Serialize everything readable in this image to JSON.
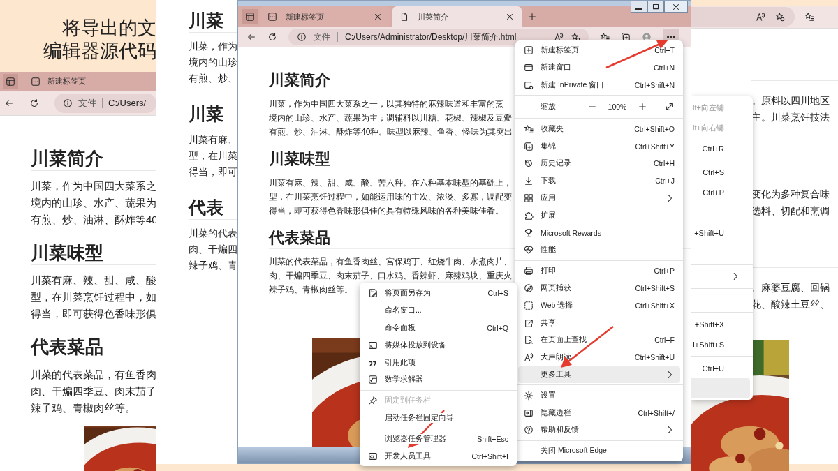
{
  "slide_title": [
    "将导出的文",
    "编辑器源代码"
  ],
  "left_window": {
    "tab": "新建标签页",
    "address_label": "文件",
    "address": "C:/Users/",
    "sections": [
      {
        "heading": "川菜简介",
        "lines": [
          "川菜，作为中国四大菜系之",
          "境内的山珍、水产、蔬果为",
          "有煎、炒、油淋、酥炸等40"
        ]
      },
      {
        "heading": "川菜味型",
        "lines": [
          "川菜有麻、辣、甜、咸、酸",
          "型，在川菜烹饪过程中，如",
          "得当，即可获得色香味形俱"
        ]
      },
      {
        "heading": "代表菜品",
        "lines": [
          "川菜的代表菜品，有鱼香肉",
          "肉、干煸四季豆、肉末茄子",
          "辣子鸡、青椒肉丝等。"
        ]
      }
    ],
    "picture": {
      "kind": "picture"
    }
  },
  "middle_page": {
    "sections": [
      {
        "heading": "川菜",
        "lines": [
          "川菜，作为",
          "境内的山珍",
          "有煎、炒、"
        ]
      },
      {
        "heading": "川菜",
        "lines": [
          "川菜有麻、",
          "型，在川菜",
          "得当，即可"
        ]
      },
      {
        "heading": "代表",
        "lines": [
          "川菜的代表",
          "肉、干煸四",
          "辣子鸡、青"
        ]
      }
    ]
  },
  "right_window": {
    "menu_groups": [
      [
        {
          "kind": "item",
          "shortcut": "lt+向左键",
          "disabled": true,
          "highlighted": false
        },
        {
          "kind": "item",
          "shortcut": "lt+向右键",
          "disabled": true,
          "highlighted": false
        },
        {
          "kind": "item",
          "shortcut": "Ctrl+R",
          "disabled": false,
          "highlighted": false
        }
      ],
      [
        {
          "kind": "item",
          "shortcut": "Ctrl+S",
          "disabled": false,
          "highlighted": false
        },
        {
          "kind": "item",
          "shortcut": "Ctrl+P",
          "disabled": false,
          "highlighted": false
        },
        {
          "kind": "blank"
        },
        {
          "kind": "item",
          "shortcut": "+Shift+U",
          "disabled": false,
          "highlighted": false
        },
        {
          "kind": "blank"
        }
      ],
      [
        {
          "kind": "item",
          "submenu": true,
          "highlighted": false
        }
      ],
      [
        {
          "kind": "blank"
        }
      ],
      [
        {
          "kind": "item",
          "shortcut": "+Shift+X",
          "disabled": false,
          "highlighted": false
        },
        {
          "kind": "item",
          "shortcut": "l+Shift+S",
          "disabled": false,
          "highlighted": false
        }
      ],
      [
        {
          "kind": "item",
          "shortcut": "Ctrl+U",
          "disabled": false,
          "highlighted": false
        },
        {
          "kind": "item",
          "highlighted": true
        }
      ]
    ],
    "sections": [
      {
        "lines": [
          "。原料以四川地区",
          "主。川菜烹饪技法"
        ]
      },
      {
        "lines": [
          "变化为多种复合味",
          "选料、切配和烹调"
        ]
      },
      {
        "lines": [
          "、麻婆豆腐、回锅",
          "花、酸辣土豆丝、"
        ]
      }
    ],
    "picture": {
      "kind": "picture"
    }
  },
  "main_window": {
    "tabs": [
      {
        "label": "新建标签页",
        "selected": false
      },
      {
        "label": "川菜简介",
        "selected": true
      }
    ],
    "address_label": "文件",
    "address": "C:/Users/Administrator/Desktop/川菜简介.html",
    "sections": [
      {
        "heading": "川菜简介",
        "lines": [
          "川菜，作为中国四大菜系之一，以其独特的麻辣味道和丰富的烹",
          "境内的山珍、水产、蔬果为主；调辅料以川糖、花椒、辣椒及豆瓣",
          "有煎、炒、油淋、酥炸等40种。味型以麻辣、鱼香、怪味为其突出"
        ]
      },
      {
        "heading": "川菜味型",
        "lines": [
          "川菜有麻、辣、甜、咸、酸、苦六种。在六种基本味型的基础上，",
          "型，在川菜烹饪过程中，如能运用味的主次、浓淡、多寡，调配变",
          "得当，即可获得色香味形俱佳的具有特殊风味的各种美味佳肴。"
        ]
      },
      {
        "heading": "代表菜品",
        "lines": [
          "川菜的代表菜品，有鱼香肉丝、宫保鸡丁、红烧牛肉、水煮肉片、",
          "肉、干煸四季豆、肉末茄子、口水鸡、香辣虾、麻辣鸡块、重庆火",
          "辣子鸡、青椒肉丝等。"
        ]
      }
    ],
    "picture": {
      "kind": "picture"
    },
    "menu": {
      "groups": [
        [
          {
            "kind": "item",
            "label": "新建标签页",
            "shortcut": "Ctrl+T",
            "highlighted": false
          },
          {
            "kind": "item",
            "label": "新建窗口",
            "shortcut": "Ctrl+N",
            "highlighted": false
          },
          {
            "kind": "item",
            "label": "新建 InPrivate 窗口",
            "shortcut": "Ctrl+Shift+N",
            "highlighted": false
          }
        ],
        [
          {
            "kind": "zoom",
            "label": "缩放",
            "value": "100%",
            "highlighted": false
          }
        ],
        [
          {
            "kind": "item",
            "label": "收藏夹",
            "shortcut": "Ctrl+Shift+O",
            "highlighted": false
          },
          {
            "kind": "item",
            "label": "集锦",
            "shortcut": "Ctrl+Shift+Y",
            "highlighted": false
          },
          {
            "kind": "item",
            "label": "历史记录",
            "shortcut": "Ctrl+H",
            "highlighted": false
          },
          {
            "kind": "item",
            "label": "下载",
            "shortcut": "Ctrl+J",
            "highlighted": false
          },
          {
            "kind": "item",
            "label": "应用",
            "submenu": true,
            "highlighted": false
          },
          {
            "kind": "item",
            "label": "扩展",
            "highlighted": false
          },
          {
            "kind": "item",
            "label": "Microsoft Rewards",
            "highlighted": false
          },
          {
            "kind": "item",
            "label": "性能",
            "highlighted": false
          }
        ],
        [
          {
            "kind": "item",
            "label": "打印",
            "shortcut": "Ctrl+P",
            "highlighted": false
          },
          {
            "kind": "item",
            "label": "网页捕获",
            "shortcut": "Ctrl+Shift+S",
            "highlighted": false
          },
          {
            "kind": "item",
            "label": "Web 选择",
            "shortcut": "Ctrl+Shift+X",
            "highlighted": false
          },
          {
            "kind": "item",
            "label": "共享",
            "highlighted": false
          },
          {
            "kind": "item",
            "label": "在页面上查找",
            "shortcut": "Ctrl+F",
            "highlighted": false
          },
          {
            "kind": "item",
            "label": "大声朗读",
            "shortcut": "Ctrl+Shift+U",
            "highlighted": false
          },
          {
            "kind": "item",
            "label": "更多工具",
            "submenu": true,
            "highlighted": true
          }
        ],
        [
          {
            "kind": "item",
            "label": "设置",
            "highlighted": false
          },
          {
            "kind": "item",
            "label": "隐藏边栏",
            "shortcut": "Ctrl+Shift+/",
            "highlighted": false
          },
          {
            "kind": "item",
            "label": "帮助和反馈",
            "submenu": true,
            "highlighted": false
          }
        ],
        [
          {
            "kind": "item",
            "label": "关闭 Microsoft Edge",
            "highlighted": false
          }
        ]
      ]
    },
    "submenu": {
      "groups": [
        [
          {
            "label": "将页面另存为",
            "shortcut": "Ctrl+S",
            "disabled": false
          },
          {
            "label": "命名窗口...",
            "disabled": false
          },
          {
            "label": "命令面板",
            "shortcut": "Ctrl+Q",
            "disabled": false
          },
          {
            "label": "将媒体投放到设备",
            "disabled": false
          },
          {
            "label": "引用此项",
            "disabled": false
          },
          {
            "label": "数学求解器",
            "disabled": false
          }
        ],
        [
          {
            "label": "固定到任务栏",
            "disabled": true
          },
          {
            "label": "启动任务栏固定向导",
            "disabled": false
          }
        ],
        [
          {
            "label": "浏览器任务管理器",
            "shortcut": "Shift+Esc",
            "disabled": false
          },
          {
            "label": "开发人员工具",
            "shortcut": "Ctrl+Shift+I",
            "disabled": false
          }
        ]
      ]
    }
  }
}
